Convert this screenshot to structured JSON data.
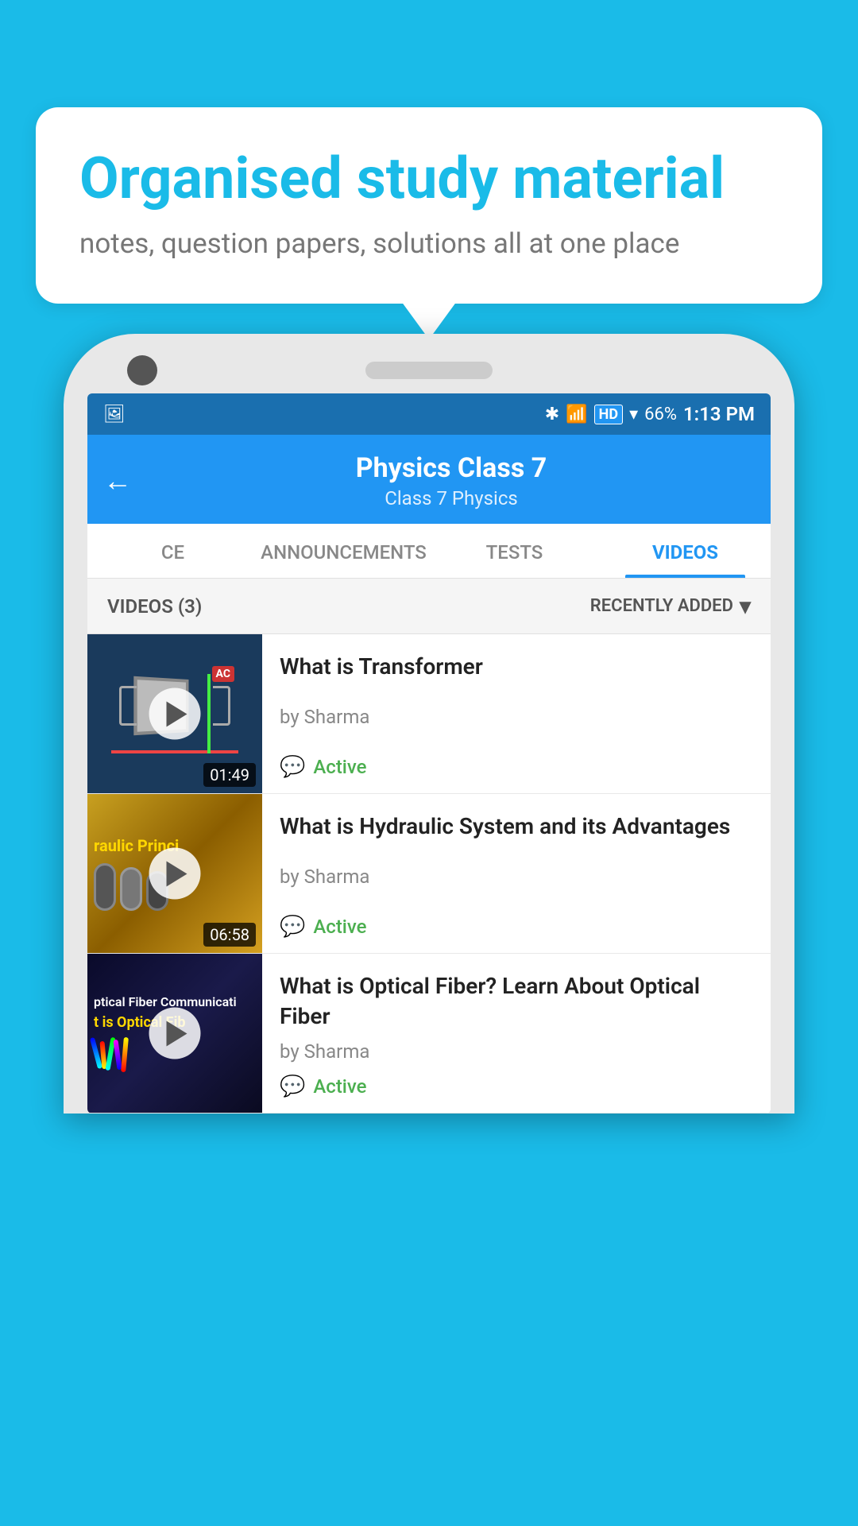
{
  "background_color": "#1ABBE8",
  "bubble": {
    "title": "Organised study material",
    "subtitle": "notes, question papers, solutions all at one place"
  },
  "status_bar": {
    "time": "1:13 PM",
    "battery": "66%",
    "icons": [
      "bluetooth",
      "vibrate",
      "hd",
      "wifi",
      "signal",
      "battery"
    ]
  },
  "header": {
    "back_label": "←",
    "title": "Physics Class 7",
    "subtitle": "Class 7    Physics"
  },
  "tabs": [
    {
      "id": "ce",
      "label": "CE",
      "active": false
    },
    {
      "id": "announcements",
      "label": "ANNOUNCEMENTS",
      "active": false
    },
    {
      "id": "tests",
      "label": "TESTS",
      "active": false
    },
    {
      "id": "videos",
      "label": "VIDEOS",
      "active": true
    }
  ],
  "filter_bar": {
    "count_label": "VIDEOS (3)",
    "sort_label": "RECENTLY ADDED",
    "sort_icon": "chevron-down"
  },
  "videos": [
    {
      "id": 1,
      "title": "What is  Transformer",
      "author": "by Sharma",
      "status": "Active",
      "duration": "01:49",
      "thumb_type": "transformer"
    },
    {
      "id": 2,
      "title": "What is Hydraulic System and its Advantages",
      "author": "by Sharma",
      "status": "Active",
      "duration": "06:58",
      "thumb_type": "hydraulic",
      "thumb_text": "raulic Princi"
    },
    {
      "id": 3,
      "title": "What is Optical Fiber? Learn About Optical Fiber",
      "author": "by Sharma",
      "status": "Active",
      "duration": "",
      "thumb_type": "optical",
      "thumb_text": "ptical Fiber Communicati",
      "thumb_text2": "t is Optical Fib"
    }
  ],
  "icons": {
    "play": "▶",
    "chat": "💬",
    "chevron_down": "▾"
  }
}
